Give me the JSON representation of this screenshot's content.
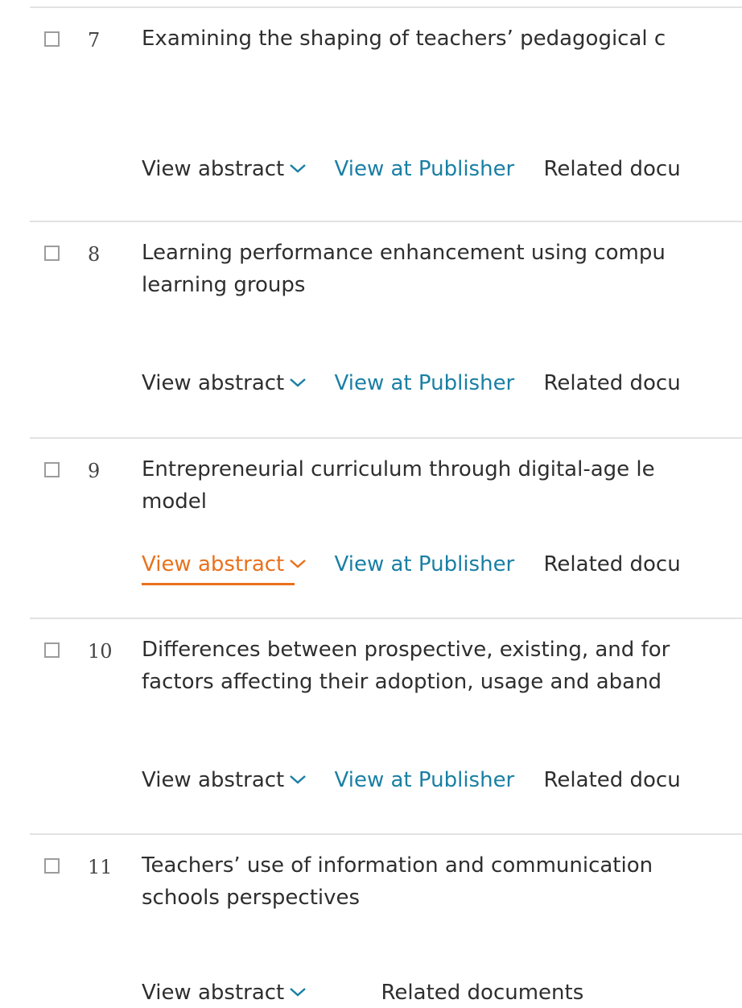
{
  "results": [
    {
      "number": "7",
      "title_line1": "Examining the shaping of teachers’ pedagogical c",
      "title_line2": "",
      "view_abstract": "View abstract",
      "view_publisher": "View at Publisher",
      "related": "Related docu"
    },
    {
      "number": "8",
      "title_line1": "Learning performance enhancement using compu",
      "title_line2": "learning groups",
      "view_abstract": "View abstract",
      "view_publisher": "View at Publisher",
      "related": "Related docu"
    },
    {
      "number": "9",
      "title_line1": "Entrepreneurial curriculum through digital-age le",
      "title_line2": "model",
      "view_abstract": "View abstract",
      "view_publisher": "View at Publisher",
      "related": "Related docu"
    },
    {
      "number": "10",
      "title_line1": "Differences between prospective, existing, and for",
      "title_line2": "factors affecting their adoption, usage and aband",
      "view_abstract": "View abstract",
      "view_publisher": "View at Publisher",
      "related": "Related docu"
    },
    {
      "number": "11",
      "title_line1": "Teachers’ use of information and communication",
      "title_line2": "schools perspectives",
      "view_abstract": "View abstract",
      "related": "Related documents"
    }
  ],
  "colors": {
    "link": "#1a7fa4",
    "active": "#e9711c",
    "text": "#2e2e2e",
    "separator": "#e2e2e2"
  },
  "icons": {
    "chevron": "chevron-down-icon",
    "checkbox": "checkbox-icon"
  }
}
